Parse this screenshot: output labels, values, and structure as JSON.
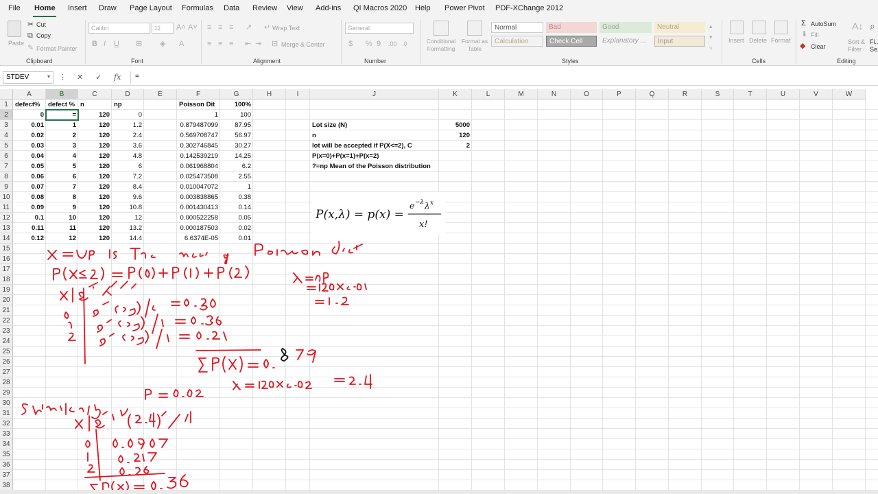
{
  "ribbon_tabs": [
    "File",
    "Home",
    "Insert",
    "Draw",
    "Page Layout",
    "Formulas",
    "Data",
    "Review",
    "View",
    "Add-ins",
    "QI Macros 2020",
    "Help",
    "Power Pivot",
    "PDF-XChange 2012"
  ],
  "active_tab": "Home",
  "clipboard": {
    "paste": "Paste",
    "cut": "Cut",
    "copy": "Copy",
    "format_painter": "Format Painter",
    "label": "Clipboard"
  },
  "font": {
    "name": "Calibri",
    "size": "11",
    "label": "Font"
  },
  "alignment": {
    "wrap": "Wrap Text",
    "merge": "Merge & Center",
    "label": "Alignment"
  },
  "number": {
    "format": "General",
    "label": "Number"
  },
  "styles": {
    "conditional": "Conditional Formatting",
    "format_table": "Format as Table",
    "cells": [
      "Normal",
      "Bad",
      "Good",
      "Neutral",
      "Calculation",
      "Check Cell",
      "Explanatory ...",
      "Input"
    ],
    "label": "Styles"
  },
  "cells_group": {
    "insert": "Insert",
    "delete": "Delete",
    "format": "Format",
    "label": "Cells"
  },
  "editing": {
    "autosum": "AutoSum",
    "fill": "Fill",
    "clear": "Clear",
    "sort": "Sort & Filter",
    "find": "Fi... Se...",
    "label": "Editing"
  },
  "formula_bar": {
    "name_box": "STDEV",
    "content": "="
  },
  "columns": [
    "A",
    "B",
    "C",
    "D",
    "E",
    "F",
    "G",
    "H",
    "I",
    "J",
    "K",
    "L",
    "M",
    "N",
    "O",
    "P",
    "Q",
    "R",
    "S",
    "T",
    "U",
    "V",
    "W"
  ],
  "rows": [
    "1",
    "2",
    "3",
    "4",
    "5",
    "6",
    "7",
    "8",
    "9",
    "10",
    "11",
    "12",
    "13",
    "14",
    "15",
    "16",
    "17",
    "18",
    "19",
    "20",
    "21",
    "22",
    "23",
    "24",
    "25",
    "26",
    "27",
    "28",
    "29",
    "30",
    "31",
    "32",
    "33",
    "34",
    "35",
    "36",
    "37",
    "38"
  ],
  "headers": {
    "A": "defect%",
    "B": "defect %",
    "C": "n",
    "D": "np",
    "F": "Poisson Dit",
    "G": "100%"
  },
  "table_rows": [
    {
      "A": "0",
      "B": "=",
      "C": "120",
      "D": "0",
      "F": "1",
      "G": "100"
    },
    {
      "A": "0.01",
      "B": "1",
      "C": "120",
      "D": "1.2",
      "F": "0.879487099",
      "G": "87.95"
    },
    {
      "A": "0.02",
      "B": "2",
      "C": "120",
      "D": "2.4",
      "F": "0.569708747",
      "G": "56.97"
    },
    {
      "A": "0.03",
      "B": "3",
      "C": "120",
      "D": "3.6",
      "F": "0.302746845",
      "G": "30.27"
    },
    {
      "A": "0.04",
      "B": "4",
      "C": "120",
      "D": "4.8",
      "F": "0.142539219",
      "G": "14.25"
    },
    {
      "A": "0.05",
      "B": "5",
      "C": "120",
      "D": "6",
      "F": "0.061968804",
      "G": "6.2"
    },
    {
      "A": "0.06",
      "B": "6",
      "C": "120",
      "D": "7.2",
      "F": "0.025473508",
      "G": "2.55"
    },
    {
      "A": "0.07",
      "B": "7",
      "C": "120",
      "D": "8.4",
      "F": "0.010047072",
      "G": "1"
    },
    {
      "A": "0.08",
      "B": "8",
      "C": "120",
      "D": "9.6",
      "F": "0.003838865",
      "G": "0.38"
    },
    {
      "A": "0.09",
      "B": "9",
      "C": "120",
      "D": "10.8",
      "F": "0.001430413",
      "G": "0.14"
    },
    {
      "A": "0.1",
      "B": "10",
      "C": "120",
      "D": "12",
      "F": "0.000522258",
      "G": "0.05"
    },
    {
      "A": "0.11",
      "B": "11",
      "C": "120",
      "D": "13.2",
      "F": "0.000187503",
      "G": "0.02"
    },
    {
      "A": "0.12",
      "B": "12",
      "C": "120",
      "D": "14.4",
      "F": "6.6374E-05",
      "G": "0.01"
    }
  ],
  "notes": [
    {
      "label": "Lot size (N)",
      "value": "5000"
    },
    {
      "label": "n",
      "value": "120"
    },
    {
      "label": "lot will be accepted if P(X<=2), C",
      "value": "2"
    },
    {
      "label": "P(x=0)+P(x=1)+P(x=2)",
      "value": ""
    },
    {
      "label": "?=np  Mean of the Poisson distribution",
      "value": ""
    }
  ],
  "formula_image": "P(x,λ) = p(x) = e^{-λ} λ^x / x!",
  "colors": {
    "accent": "#217346",
    "ink": "#e0141e"
  }
}
